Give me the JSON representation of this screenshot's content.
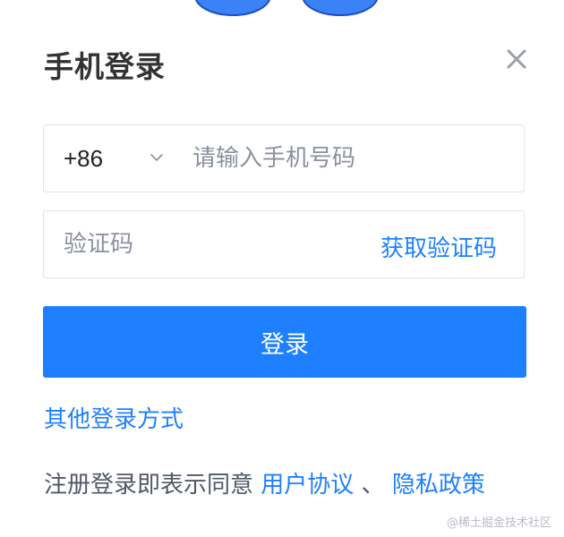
{
  "dialog": {
    "title": "手机登录",
    "close_icon": "close-icon"
  },
  "phone": {
    "area_code": "+86",
    "placeholder": "请输入手机号码",
    "value": ""
  },
  "code": {
    "placeholder": "验证码",
    "value": "",
    "get_code_label": "获取验证码"
  },
  "actions": {
    "login_label": "登录",
    "other_login_label": "其他登录方式"
  },
  "agreement": {
    "prefix": "注册登录即表示同意",
    "user_agreement": "用户协议",
    "separator": "、",
    "privacy_policy": "隐私政策"
  },
  "watermark": "@稀土掘金技术社区",
  "colors": {
    "accent": "#1e80ff",
    "mascot": "#3b82f6",
    "border": "#e2e4e8"
  }
}
